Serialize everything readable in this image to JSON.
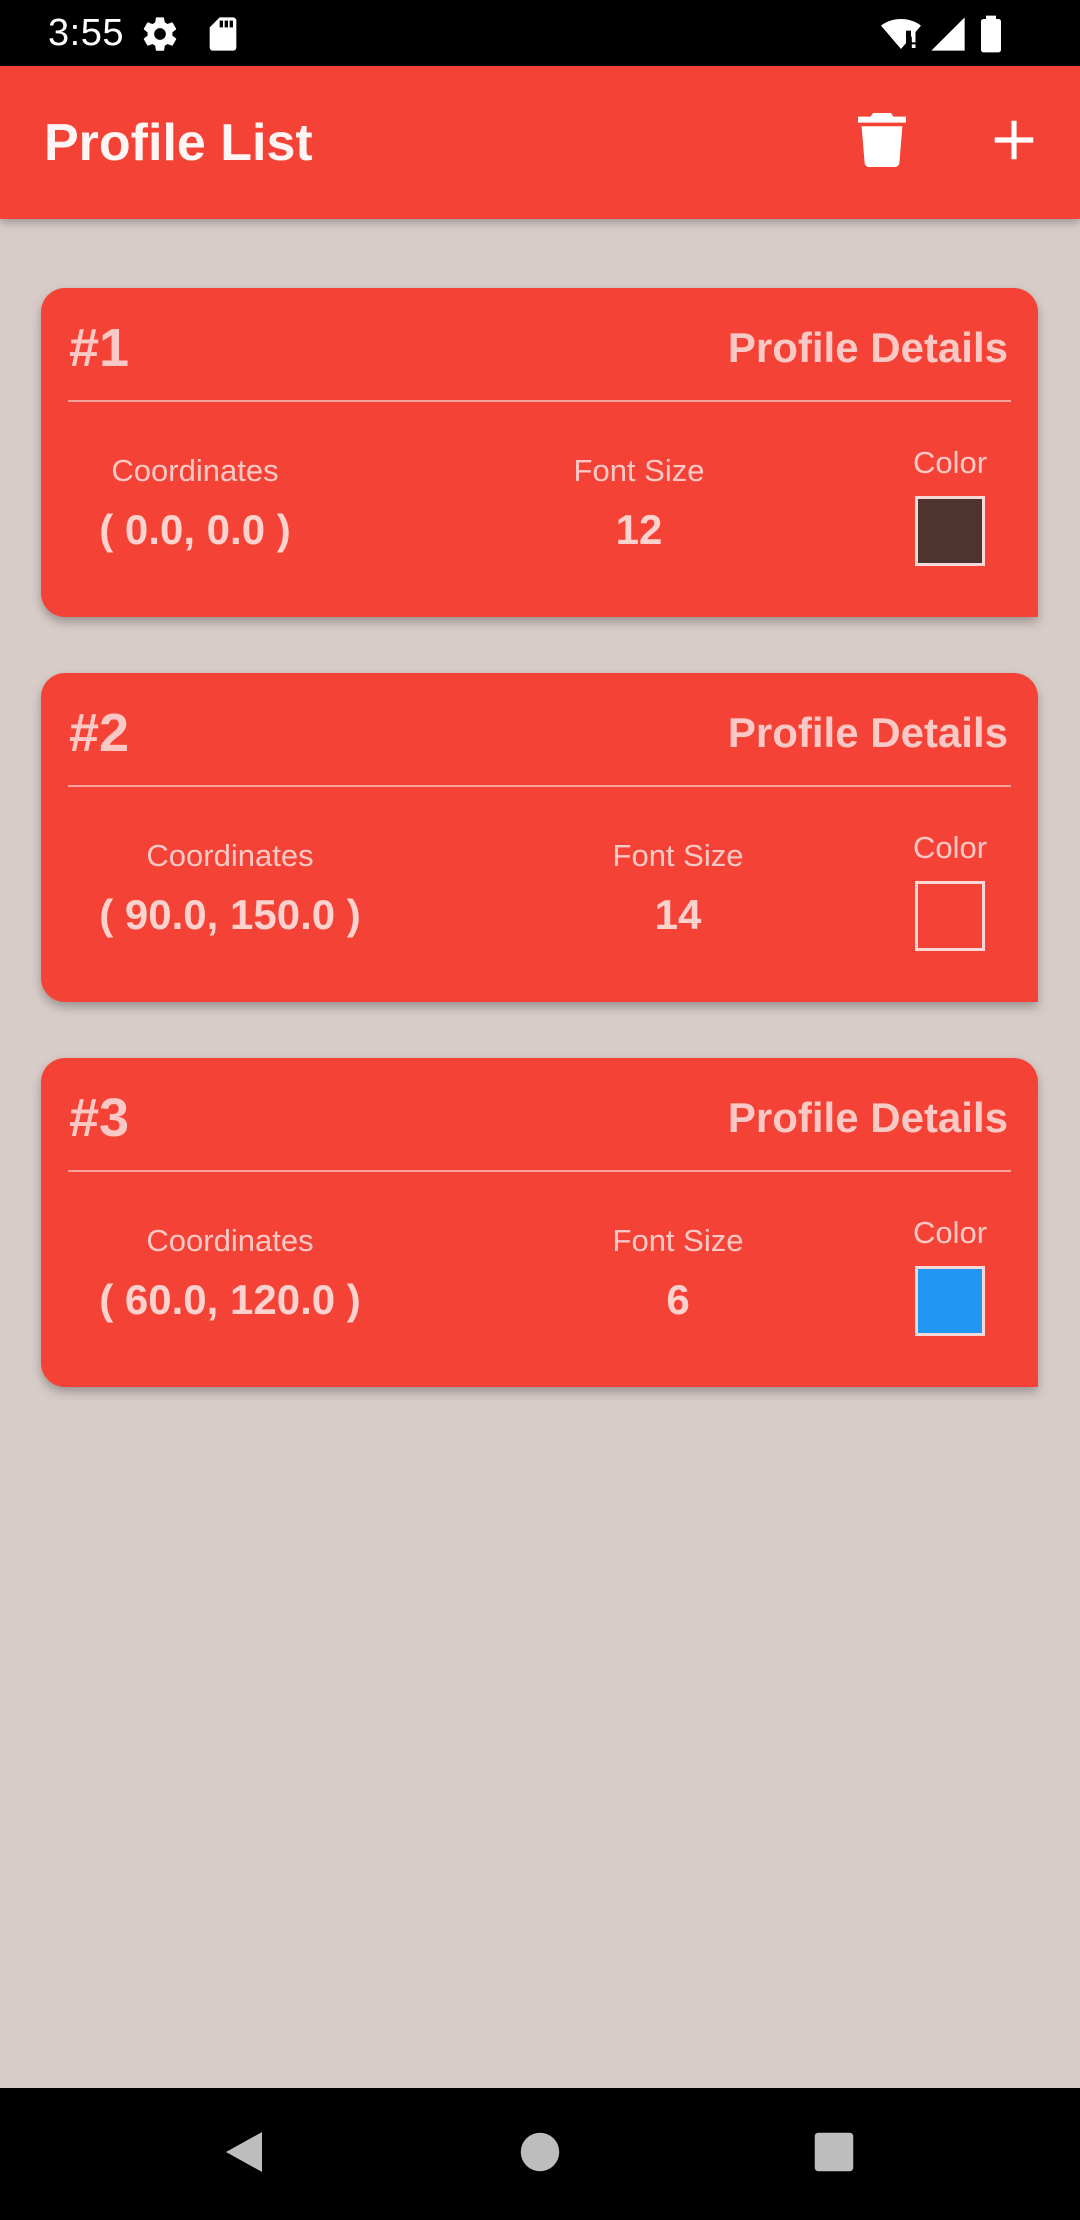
{
  "status_bar": {
    "time": "3:55",
    "icons": [
      "gear-icon",
      "sd-card-icon",
      "wifi-icon",
      "signal-icon",
      "battery-icon"
    ]
  },
  "app_bar": {
    "title": "Profile List",
    "actions": [
      "trash-icon",
      "add-icon"
    ]
  },
  "profiles": [
    {
      "number": "#1",
      "details_label": "Profile Details",
      "coordinates_label": "Coordinates",
      "coordinates": "( 0.0, 0.0 )",
      "font_size_label": "Font Size",
      "font_size": "12",
      "color_label": "Color",
      "color": "#4e342e"
    },
    {
      "number": "#2",
      "details_label": "Profile Details",
      "coordinates_label": "Coordinates",
      "coordinates": "( 90.0, 150.0 )",
      "font_size_label": "Font Size",
      "font_size": "14",
      "color_label": "Color",
      "color": "#f44336"
    },
    {
      "number": "#3",
      "details_label": "Profile Details",
      "coordinates_label": "Coordinates",
      "coordinates": "( 60.0, 120.0 )",
      "font_size_label": "Font Size",
      "font_size": "6",
      "color_label": "Color",
      "color": "#2196f3"
    }
  ],
  "nav_bar": {
    "buttons": [
      "back-icon",
      "home-icon",
      "recents-icon"
    ]
  },
  "colors": {
    "primary": "#f44336",
    "background": "#d7ccc8",
    "card_text": "#fbc9c5"
  }
}
